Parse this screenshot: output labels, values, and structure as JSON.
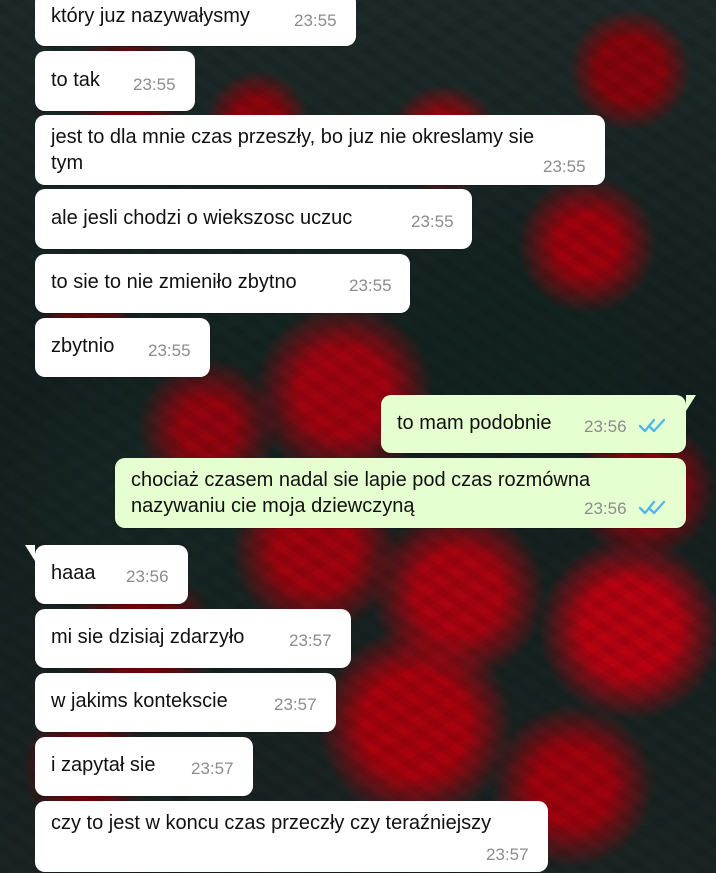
{
  "theme": {
    "incoming_bubble": "#ffffff",
    "outgoing_bubble": "#e5ffd1",
    "timestamp_color": "#8c8c8c",
    "read_receipt_color": "#4fb6ec"
  },
  "messages": [
    {
      "direction": "incoming",
      "text": "który juz nazywałysmy",
      "time": "23:55"
    },
    {
      "direction": "incoming",
      "text": "to tak",
      "time": "23:55"
    },
    {
      "direction": "incoming",
      "text": "jest to dla mnie czas przeszły, bo juz nie okreslamy sie\ntym",
      "time": "23:55"
    },
    {
      "direction": "incoming",
      "text": "ale jesli chodzi o wiekszosc uczuc",
      "time": "23:55"
    },
    {
      "direction": "incoming",
      "text": "to sie to nie zmieniło zbytno",
      "time": "23:55"
    },
    {
      "direction": "incoming",
      "text": "zbytnio",
      "time": "23:55"
    },
    {
      "direction": "outgoing",
      "text": "to mam podobnie",
      "time": "23:56",
      "status": "read-receipt-icon"
    },
    {
      "direction": "outgoing",
      "text": "chociaż czasem nadal sie lapie pod czas rozmówna\nnazywaniu cie moja dziewczyną",
      "time": "23:56",
      "status": "read-receipt-icon"
    },
    {
      "direction": "incoming",
      "text": "haaa",
      "time": "23:56"
    },
    {
      "direction": "incoming",
      "text": "mi sie dzisiaj zdarzyło",
      "time": "23:57"
    },
    {
      "direction": "incoming",
      "text": "w jakims kontekscie",
      "time": "23:57"
    },
    {
      "direction": "incoming",
      "text": "i zapytał sie",
      "time": "23:57"
    },
    {
      "direction": "incoming",
      "text": "czy to jest w koncu czas przeczły czy teraźniejszy",
      "time": "23:57"
    }
  ]
}
